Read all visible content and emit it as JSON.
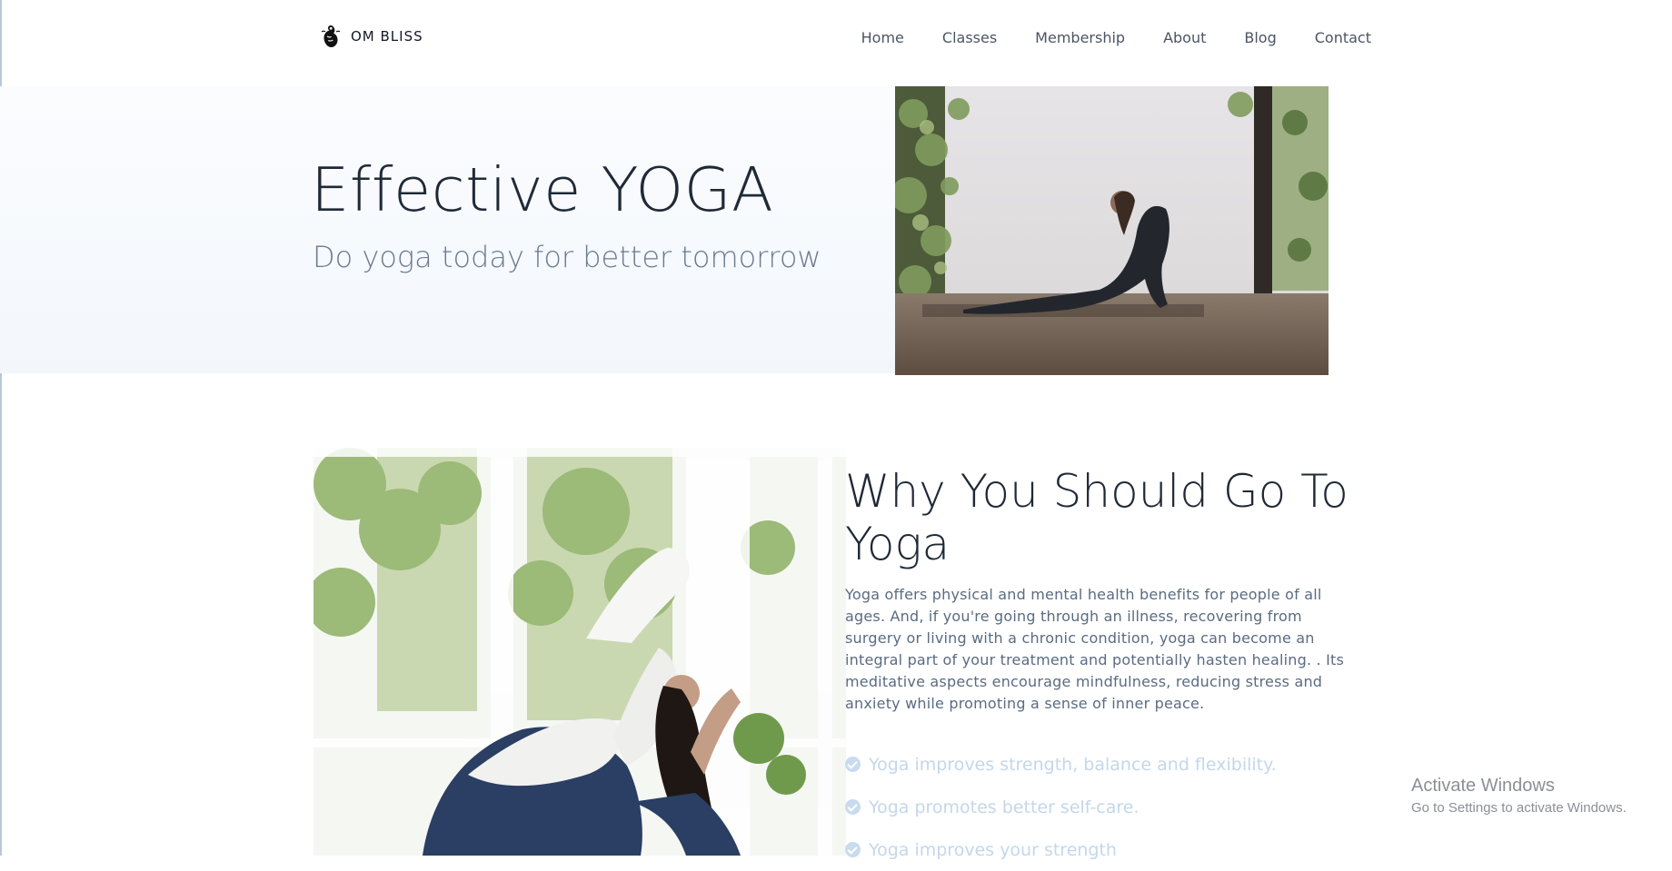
{
  "brand": {
    "name": "OM BLISS",
    "icon": "meditation-hand-logo-icon"
  },
  "nav": {
    "items": [
      {
        "label": "Home"
      },
      {
        "label": "Classes"
      },
      {
        "label": "Membership"
      },
      {
        "label": "About"
      },
      {
        "label": "Blog"
      },
      {
        "label": "Contact"
      }
    ]
  },
  "hero": {
    "title": "Effective YOGA",
    "subtitle": "Do yoga today for better tomorrow",
    "image": "woman-cobra-pose-photo"
  },
  "why": {
    "title": "Why You Should Go To Yoga",
    "body": "Yoga offers physical and mental health benefits for people of all ages. And, if you're going through an illness, recovering from surgery or living with a chronic condition, yoga can become an integral part of your treatment and potentially hasten healing. . Its meditative aspects encourage mindfulness, reducing stress and anxiety while promoting a sense of inner peace.",
    "image": "woman-pigeon-pose-photo",
    "benefits": [
      {
        "text": "Yoga improves strength, balance and flexibility.",
        "icon": "check-circle-icon"
      },
      {
        "text": "Yoga promotes better self-care.",
        "icon": "check-circle-icon"
      },
      {
        "text": "Yoga improves your strength",
        "icon": "check-circle-icon"
      }
    ]
  },
  "watermark": {
    "title": "Activate Windows",
    "subtitle": "Go to Settings to activate Windows."
  },
  "colors": {
    "heading": "#1f2937",
    "subtitle": "#6b7a90",
    "body": "#5a6b82",
    "benefit": "#c4d7ea",
    "hero_band": "#f3f7fc"
  }
}
